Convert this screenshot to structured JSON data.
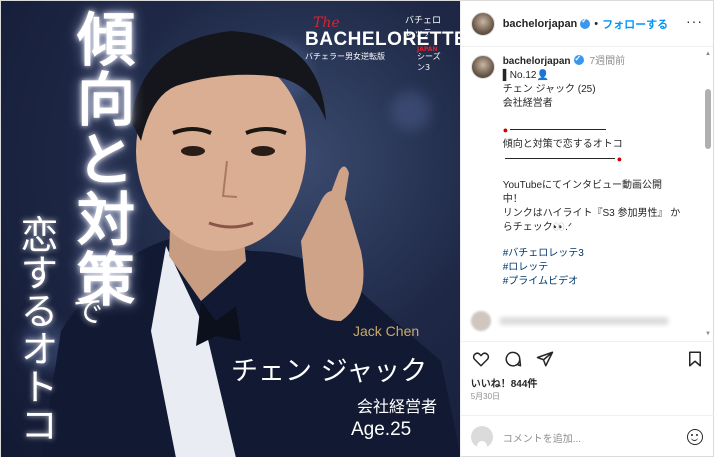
{
  "post_image": {
    "headline_vertical": "傾向と対策",
    "headline_de": "で",
    "headline_sub_vertical": "恋するオトコ",
    "logo": {
      "top_label": "バチェロレッテ",
      "the": "The",
      "main": "BACHELORETTE",
      "japan": "JAPAN",
      "sub": "バチェラー男女逆転版",
      "season": "シーズン3"
    },
    "name_en": "Jack Chen",
    "name_jp": "チェン ジャック",
    "occupation": "会社経営者",
    "age": "Age.25"
  },
  "header": {
    "username": "bachelorjapan",
    "separator": "•",
    "follow_label": "フォローする",
    "more_label": "···"
  },
  "caption": {
    "username": "bachelorjapan",
    "time_ago": "7週間前",
    "lines": [
      "▌No.12👤",
      "チェン ジャック (25)",
      "会社経営者"
    ],
    "theme": "傾向と対策で恋するオトコ",
    "interview_lines": [
      "YouTubeにてインタビュー動画公開",
      "中！",
      "リンクはハイライト『S3 参加男性』 か",
      "らチェック👀.ᐟ"
    ],
    "hashtags": [
      "#バチェロレッテ3",
      "#ロレッテ",
      "#プライムビデオ"
    ]
  },
  "stats": {
    "likes": "いいね！844件",
    "date": "5月30日"
  },
  "add_comment": {
    "placeholder": "コメントを追加..."
  },
  "colors": {
    "accent_blue": "#0095f6",
    "hashtag": "#00376b",
    "logo_red": "#d9232e",
    "name_gold": "#c9a96a"
  }
}
